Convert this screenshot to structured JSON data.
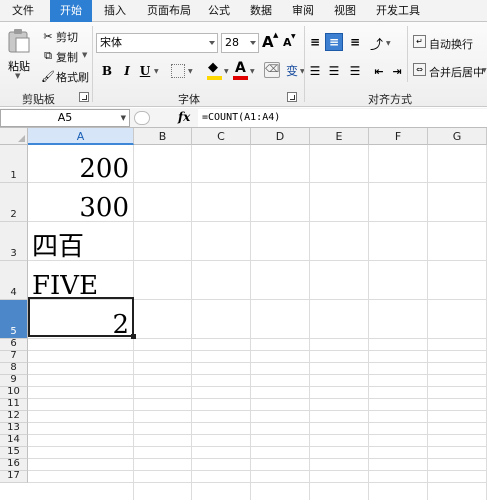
{
  "menu": {
    "tabs": [
      "文件",
      "开始",
      "插入",
      "页面布局",
      "公式",
      "数据",
      "审阅",
      "视图",
      "开发工具"
    ]
  },
  "ribbon": {
    "clipboard": {
      "paste": "粘贴",
      "cut": "剪切",
      "copy": "复制",
      "format_painter": "格式刷",
      "group": "剪贴板"
    },
    "font": {
      "name": "宋体",
      "size": "28",
      "bold": "B",
      "italic": "I",
      "underline": "U",
      "font_color_glyph": "A",
      "grow_glyph": "A",
      "shrink_glyph": "A",
      "phonetic_glyph": "变",
      "group": "字体"
    },
    "alignment": {
      "wrap_text": "自动换行",
      "merge_center": "合并后居中",
      "group": "对齐方式"
    }
  },
  "formula_bar": {
    "name_box": "A5",
    "fx": "fx",
    "formula": "=COUNT(A1:A4)"
  },
  "sheet": {
    "columns": [
      "A",
      "B",
      "C",
      "D",
      "E",
      "F",
      "G"
    ],
    "rows": [
      "1",
      "2",
      "3",
      "4",
      "5",
      "6",
      "7",
      "8",
      "9",
      "10",
      "11",
      "12",
      "13",
      "14",
      "15",
      "16",
      "17"
    ],
    "cells": {
      "A1": "200",
      "A2": "300",
      "A3": "四百",
      "A4": "FIVE",
      "A5": "2"
    },
    "active_cell": "A5"
  },
  "colors": {
    "accent": "#2d7fd4",
    "selected_header": "#4c87c9"
  }
}
